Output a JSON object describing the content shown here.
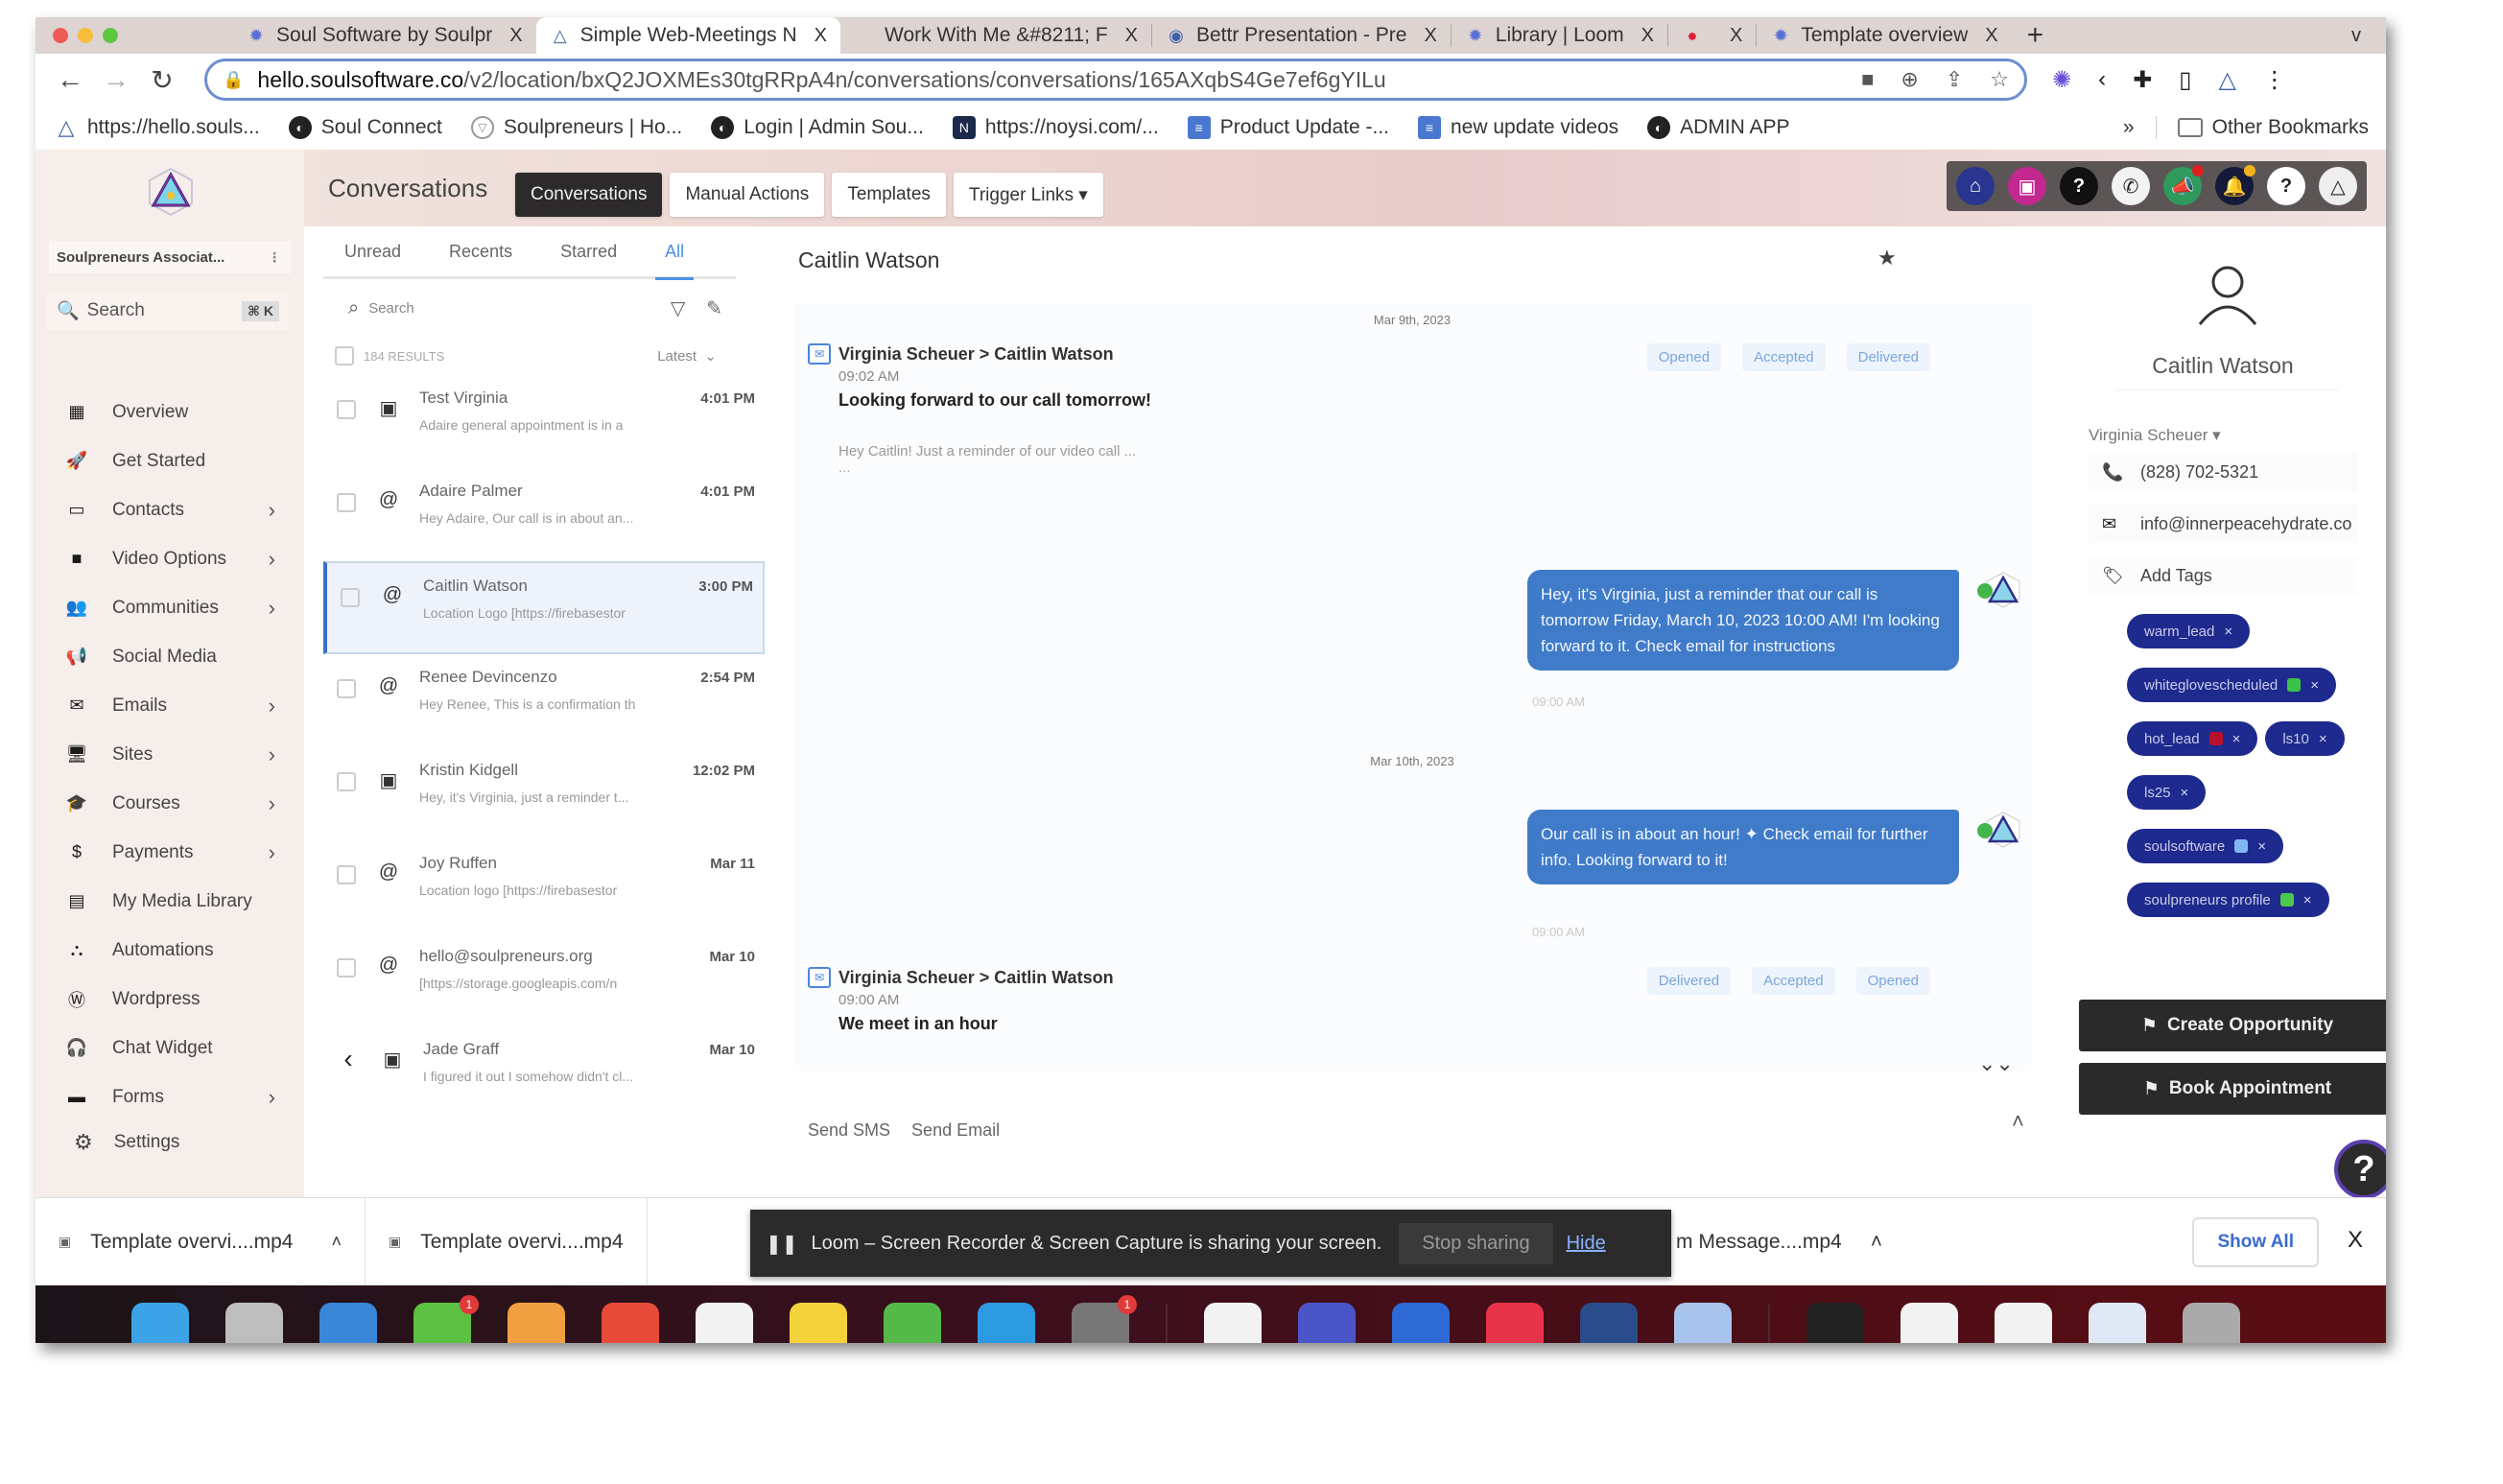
{
  "browser": {
    "tabs": [
      {
        "title": "Soul Software by Soulpr",
        "icon": "gear-icon",
        "active": false
      },
      {
        "title": "Simple Web-Meetings N",
        "icon": "triangle-logo-icon",
        "active": true
      },
      {
        "title": "Work With Me &#8211; F",
        "icon": "",
        "active": false
      },
      {
        "title": "Bettr Presentation - Pre",
        "icon": "circle-logo-icon",
        "active": false
      },
      {
        "title": "Library | Loom",
        "icon": "gear-icon",
        "active": false
      },
      {
        "title": "",
        "icon": "recording-dot-icon",
        "active": false
      },
      {
        "title": "Template overview",
        "icon": "gear-icon",
        "active": false
      }
    ],
    "new_tab": "+",
    "tab_menu": "v",
    "close_glyph": "X",
    "url_host": "hello.soulsoftware.co",
    "url_path": "/v2/location/bxQ2JOXMEs30tgRRpA4n/conversations/conversations/165AXqbS4Ge7ef6gYILu",
    "bookmarks": [
      {
        "label": "https://hello.souls...",
        "icon": "triangle"
      },
      {
        "label": "Soul Connect",
        "icon": "globe"
      },
      {
        "label": "Soulpreneurs | Ho...",
        "icon": "shield"
      },
      {
        "label": "Login | Admin Sou...",
        "icon": "globe"
      },
      {
        "label": "https://noysi.com/...",
        "icon": "dark"
      },
      {
        "label": "Product Update -...",
        "icon": "doc"
      },
      {
        "label": "new update videos",
        "icon": "doc"
      },
      {
        "label": "ADMIN APP",
        "icon": "globe"
      }
    ],
    "bookmarks_more": "»",
    "other_bookmarks": "Other Bookmarks"
  },
  "app": {
    "location_name": "Soulpreneurs Associat...",
    "search_placeholder": "Search",
    "search_shortcut": "⌘ K",
    "nav": [
      {
        "label": "Overview",
        "icon": "▦",
        "chevron": false
      },
      {
        "label": "Get Started",
        "icon": "🚀",
        "chevron": false
      },
      {
        "label": "Contacts",
        "icon": "▭",
        "chevron": true
      },
      {
        "label": "Video Options",
        "icon": "■",
        "chevron": true
      },
      {
        "label": "Communities",
        "icon": "👥",
        "chevron": true
      },
      {
        "label": "Social Media",
        "icon": "📢",
        "chevron": false
      },
      {
        "label": "Emails",
        "icon": "✉",
        "chevron": true
      },
      {
        "label": "Sites",
        "icon": "🖥",
        "chevron": true
      },
      {
        "label": "Courses",
        "icon": "🎓",
        "chevron": true
      },
      {
        "label": "Payments",
        "icon": "$",
        "chevron": true
      },
      {
        "label": "My Media Library",
        "icon": "▤",
        "chevron": false
      },
      {
        "label": "Automations",
        "icon": "⛬",
        "chevron": false
      },
      {
        "label": "Wordpress",
        "icon": "Ⓦ",
        "chevron": false
      },
      {
        "label": "Chat Widget",
        "icon": "🎧",
        "chevron": false
      },
      {
        "label": "Forms",
        "icon": "▬",
        "chevron": true
      }
    ],
    "settings_label": "Settings",
    "page_title": "Conversations",
    "top_tabs": [
      {
        "label": "Conversations",
        "active": true
      },
      {
        "label": "Manual Actions",
        "active": false
      },
      {
        "label": "Templates",
        "active": false
      },
      {
        "label": "Trigger Links ▾",
        "active": false
      }
    ],
    "header_icons": [
      {
        "name": "home-icon",
        "glyph": "⌂",
        "bg": "#2a3590"
      },
      {
        "name": "store-icon",
        "glyph": "▣",
        "bg": "#c2288f"
      },
      {
        "name": "help-icon",
        "glyph": "?",
        "bg": "#111111"
      },
      {
        "name": "phone-icon",
        "glyph": "✆",
        "bg": "#f3f3f3"
      },
      {
        "name": "megaphone-icon",
        "glyph": "📣",
        "bg": "#2f9a5c",
        "dot": "#e02020"
      },
      {
        "name": "bell-icon",
        "glyph": "🔔",
        "bg": "#151a3a",
        "dot": "#f2b21c"
      },
      {
        "name": "question-icon",
        "glyph": "?",
        "bg": "#ffffff"
      },
      {
        "name": "profile-logo-icon",
        "glyph": "△",
        "bg": "#eeeeee"
      }
    ]
  },
  "conversations": {
    "filters": [
      {
        "label": "Unread",
        "active": false
      },
      {
        "label": "Recents",
        "active": false
      },
      {
        "label": "Starred",
        "active": false
      },
      {
        "label": "All",
        "active": true
      }
    ],
    "search_placeholder": "Search",
    "results_label": "184 RESULTS",
    "sort_label": "Latest",
    "items": [
      {
        "name": "Test Virginia",
        "preview": "Adaire general appointment is in a",
        "time": "4:01 PM",
        "channel": "sms",
        "selected": false
      },
      {
        "name": "Adaire Palmer",
        "preview": "Hey Adaire, Our call is in about an...",
        "time": "4:01 PM",
        "channel": "email",
        "selected": false
      },
      {
        "name": "Caitlin Watson",
        "preview": "Location Logo [https://firebasestor",
        "time": "3:00 PM",
        "channel": "email",
        "selected": true
      },
      {
        "name": "Renee Devincenzo",
        "preview": "Hey Renee, This is a confirmation th",
        "time": "2:54 PM",
        "channel": "email",
        "selected": false
      },
      {
        "name": "Kristin Kidgell",
        "preview": "Hey, it's Virginia, just a reminder t...",
        "time": "12:02 PM",
        "channel": "sms",
        "selected": false
      },
      {
        "name": "Joy Ruffen",
        "preview": "Location logo [https://firebasestor",
        "time": "Mar 11",
        "channel": "email",
        "selected": false
      },
      {
        "name": "hello@soulpreneurs.org",
        "preview": "[https://storage.googleapis.com/n",
        "time": "Mar 10",
        "channel": "email",
        "selected": false
      },
      {
        "name": "Jade Graff",
        "preview": "I figured it out I somehow didn't cl...",
        "time": "Mar 10",
        "channel": "sms",
        "selected": false
      }
    ]
  },
  "thread": {
    "title": "Caitlin Watson",
    "date_1": "Mar 9th, 2023",
    "email_1": {
      "from_to": "Virginia Scheuer > Caitlin Watson",
      "time": "09:02 AM",
      "subject": "Looking forward to our call tomorrow!",
      "preview": "Hey Caitlin! Just a reminder of our video call ...",
      "dots": "...",
      "badges": [
        "Opened",
        "Accepted",
        "Delivered"
      ]
    },
    "sms_1": {
      "text": "Hey, it's Virginia, just a reminder that our call is tomorrow Friday, March 10, 2023 10:00 AM! I'm looking forward to it. Check email for instructions",
      "time": "09:00 AM"
    },
    "date_2": "Mar 10th, 2023",
    "sms_2": {
      "text": "Our call is in about an hour! ✦ Check email for further info. Looking forward to it!",
      "time": "09:00 AM"
    },
    "email_2": {
      "from_to": "Virginia Scheuer > Caitlin Watson",
      "time": "09:00 AM",
      "subject": "We meet in an hour",
      "badges": [
        "Delivered",
        "Accepted",
        "Opened"
      ]
    },
    "send_sms": "Send SMS",
    "send_email": "Send Email"
  },
  "contact": {
    "name": "Caitlin Watson",
    "owner": "Virginia Scheuer ▾",
    "phone": "(828) 702-5321",
    "email": "info@innerpeacehydrate.co",
    "add_tags": "Add Tags",
    "tags": [
      {
        "label": "warm_lead",
        "dot": ""
      },
      {
        "label": "whiteglovescheduled",
        "dot": "#3cc24a"
      },
      {
        "label": "hot_lead",
        "dot": "#b8102a"
      },
      {
        "label": "ls10",
        "dot": ""
      },
      {
        "label": "ls25",
        "dot": ""
      },
      {
        "label": "soulsoftware",
        "dot": "#7fb8f0"
      },
      {
        "label": "soulpreneurs profile",
        "dot": "#4cc84c"
      }
    ],
    "create_opportunity": "Create Opportunity",
    "book_appointment": "Book Appointment",
    "help": "?"
  },
  "downloads": {
    "items": [
      "Template overvi....mp4",
      "Template overvi....mp4",
      "m Message....mp4"
    ],
    "loom_message": "Loom – Screen Recorder & Screen Capture is sharing your screen.",
    "stop_sharing": "Stop sharing",
    "hide": "Hide",
    "show_all": "Show All",
    "close": "X"
  },
  "dock": {
    "apps": [
      {
        "name": "finder",
        "color": "#3ba3e6"
      },
      {
        "name": "launchpad",
        "color": "#bdbdbd"
      },
      {
        "name": "safari",
        "color": "#3a86d9"
      },
      {
        "name": "messages",
        "color": "#5cc043",
        "badge": "1"
      },
      {
        "name": "photos",
        "color": "#f0a040"
      },
      {
        "name": "chrome",
        "color": "#e84a3a"
      },
      {
        "name": "contacts",
        "color": "#f2f2f2"
      },
      {
        "name": "notes",
        "color": "#f4d23a"
      },
      {
        "name": "numbers",
        "color": "#55b94a"
      },
      {
        "name": "xcode",
        "color": "#2c9ae0"
      },
      {
        "name": "system-preferences",
        "color": "#777777",
        "badge": "1"
      },
      {
        "name": "slack",
        "color": "#f2f2f2"
      },
      {
        "name": "loom",
        "color": "#4a55c8"
      },
      {
        "name": "zoom",
        "color": "#2d6ad6"
      },
      {
        "name": "music",
        "color": "#e8344a"
      },
      {
        "name": "vpn",
        "color": "#2a4c8a"
      },
      {
        "name": "preview",
        "color": "#a8c4ec"
      },
      {
        "name": "window-1",
        "color": "#222222"
      },
      {
        "name": "window-2",
        "color": "#f2f2f2"
      },
      {
        "name": "window-3",
        "color": "#f2f2f2"
      },
      {
        "name": "window-4",
        "color": "#dfe8f5"
      },
      {
        "name": "trash",
        "color": "#aaaaaa"
      }
    ]
  }
}
